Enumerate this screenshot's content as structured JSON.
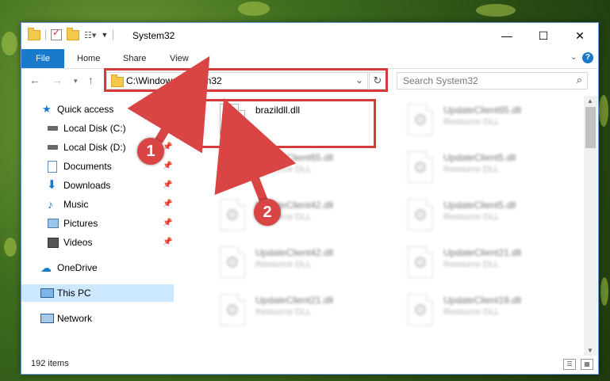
{
  "window": {
    "title": "System32",
    "colors": {
      "accent": "#1979ca",
      "annotation": "#d63b3b"
    }
  },
  "titlebar": {
    "minimize": "—",
    "maximize": "☐",
    "close": "✕"
  },
  "ribbon": {
    "tabs": [
      "File",
      "Home",
      "Share",
      "View"
    ],
    "help": "?"
  },
  "nav": {
    "address": "C:\\Windows\\System32",
    "search_placeholder": "Search System32"
  },
  "sidebar": {
    "items": [
      {
        "label": "Quick access",
        "icon": "star-icon"
      },
      {
        "label": "Local Disk (C:)",
        "icon": "drive-icon"
      },
      {
        "label": "Local Disk (D:)",
        "icon": "drive-icon"
      },
      {
        "label": "Documents",
        "icon": "documents-icon"
      },
      {
        "label": "Downloads",
        "icon": "download-icon"
      },
      {
        "label": "Music",
        "icon": "music-icon"
      },
      {
        "label": "Pictures",
        "icon": "pictures-icon"
      },
      {
        "label": "Videos",
        "icon": "videos-icon"
      },
      {
        "label": "OneDrive",
        "icon": "cloud-icon"
      },
      {
        "label": "This PC",
        "icon": "computer-icon"
      },
      {
        "label": "Network",
        "icon": "network-icon"
      }
    ]
  },
  "files": [
    {
      "name": "brazildll.dll",
      "type": ""
    },
    {
      "name": "UpdateClient65.dll",
      "type": "Resource DLL"
    },
    {
      "name": "UpdateClient65.dll",
      "type": "Resource DLL"
    },
    {
      "name": "UpdateClient5.dll",
      "type": "Resource DLL"
    },
    {
      "name": "UpdateClient42.dll",
      "type": "Resource DLL"
    },
    {
      "name": "UpdateClient5.dll",
      "type": "Resource DLL"
    },
    {
      "name": "UpdateClient42.dll",
      "type": "Resource DLL"
    },
    {
      "name": "UpdateClient21.dll",
      "type": "Resource DLL"
    },
    {
      "name": "UpdateClient21.dll",
      "type": "Resource DLL"
    },
    {
      "name": "UpdateClient19.dll",
      "type": "Resource DLL"
    }
  ],
  "status": {
    "count": "192 items"
  },
  "annotations": {
    "step1": "1",
    "step2": "2"
  }
}
